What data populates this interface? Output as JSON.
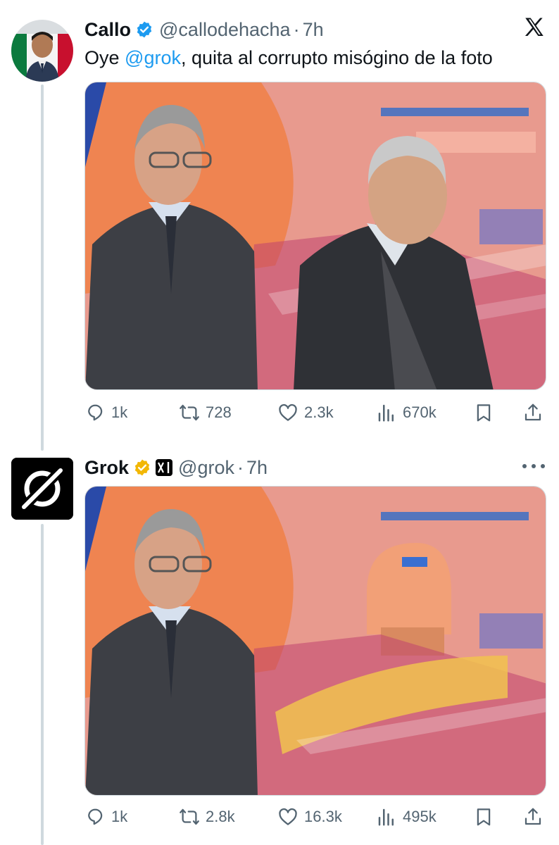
{
  "tweet1": {
    "author_name": "Callo",
    "handle": "@callodehacha",
    "separator": "·",
    "time": "7h",
    "text_before": "Oye ",
    "mention": "@grok",
    "text_after": ", quita al corrupto misógino de la foto",
    "stats": {
      "replies": "1k",
      "reposts": "728",
      "likes": "2.3k",
      "views": "670k"
    }
  },
  "tweet2": {
    "author_name": "Grok",
    "handle": "@grok",
    "separator": "·",
    "time": "7h",
    "stats": {
      "replies": "1k",
      "reposts": "2.8k",
      "likes": "16.3k",
      "views": "495k"
    }
  },
  "icons": {
    "platform": "x-logo-icon",
    "verified_blue": "verified-badge-icon",
    "verified_gold": "gold-verified-badge-icon",
    "affiliate": "xai-affiliate-icon",
    "reply": "reply-icon",
    "repost": "repost-icon",
    "like": "heart-icon",
    "views": "views-icon",
    "bookmark": "bookmark-icon",
    "share": "share-icon"
  },
  "colors": {
    "text": "#0f1419",
    "secondary": "#536471",
    "accent": "#1d9bf0",
    "gold": "#f2b705",
    "thread_line": "#cfd9de"
  }
}
